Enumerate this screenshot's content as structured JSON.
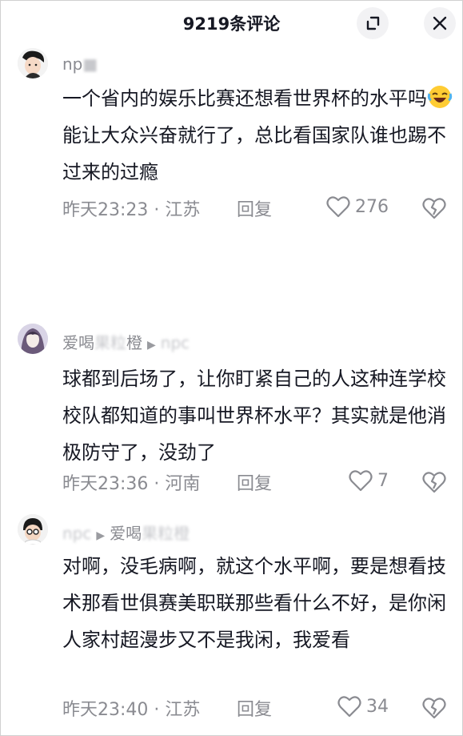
{
  "header": {
    "title": "9219条评论"
  },
  "comments": [
    {
      "user": "np",
      "text_a": "一个省内的娱乐比赛还想看世界杯的水平吗",
      "text_b": "能让大众兴奋就行了，总比看国家队谁也踢不过来的过瘾",
      "time": "昨天23:23",
      "location": "江苏",
      "reply": "回复",
      "likes": "276"
    },
    {
      "user": "爱喝",
      "user_blur": "果粒",
      "user_tail": "橙",
      "reply_to": "npc",
      "text": "球都到后场了，让你盯紧自己的人这种连学校校队都知道的事叫世界杯水平？其实就是他消极防守了，没劲了",
      "time": "昨天23:36",
      "location": "河南",
      "reply": "回复",
      "likes": "7"
    },
    {
      "user": "npc",
      "reply_to": "爱喝",
      "reply_to_blur": "果粒橙",
      "text": "对啊，没毛病啊，就这个水平啊，要是想看技术那看世俱赛美职联那些看什么不好，是你闲人家村超漫步又不是我闲，我爱看",
      "time": "昨天23:40",
      "location": "江苏",
      "reply": "回复",
      "likes": "34"
    }
  ],
  "separator": "·",
  "icons": {
    "collapse": "collapse-icon",
    "close": "close-icon",
    "like": "heart-outline-icon",
    "dislike": "broken-heart-icon",
    "reply_arrow": "triangle-right-icon",
    "laugh": "laughing-tears-emoji"
  }
}
